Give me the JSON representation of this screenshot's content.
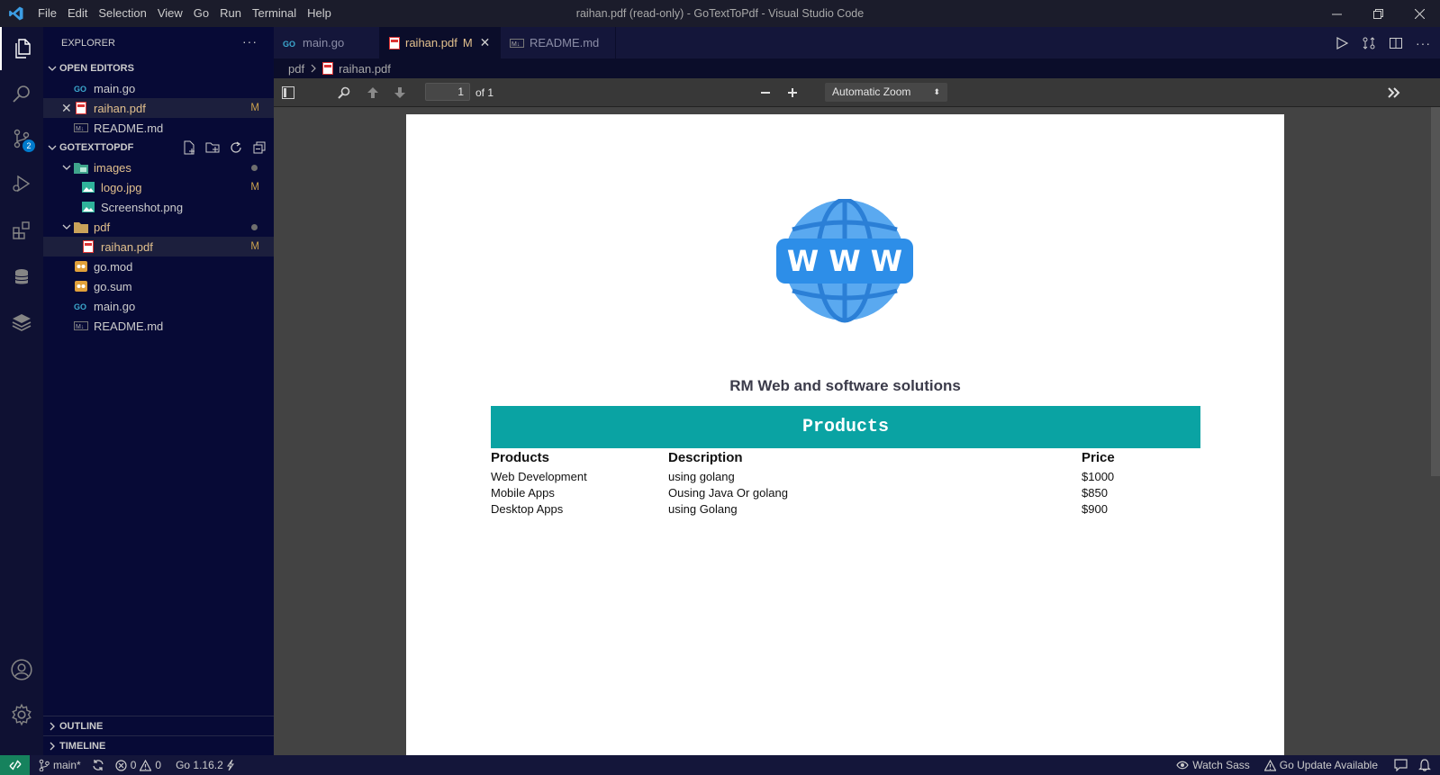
{
  "titlebar": {
    "menu": [
      "File",
      "Edit",
      "Selection",
      "View",
      "Go",
      "Run",
      "Terminal",
      "Help"
    ],
    "window_title": "raihan.pdf (read-only) - GoTextToPdf - Visual Studio Code"
  },
  "activitybar": {
    "scm_badge": "2"
  },
  "sidebar": {
    "header": "EXPLORER",
    "more": "···",
    "open_editors": {
      "title": "OPEN EDITORS",
      "items": [
        {
          "name": "main.go",
          "status": ""
        },
        {
          "name": "raihan.pdf",
          "status": "M"
        },
        {
          "name": "README.md",
          "status": ""
        }
      ]
    },
    "project": {
      "title": "GOTEXTTOPDF",
      "folder_images": "images",
      "logo": "logo.jpg",
      "logo_status": "M",
      "screenshot": "Screenshot.png",
      "folder_pdf": "pdf",
      "pdf_file": "raihan.pdf",
      "pdf_status": "M",
      "gomod": "go.mod",
      "gosum": "go.sum",
      "maingo": "main.go",
      "readme": "README.md"
    },
    "outline": "OUTLINE",
    "timeline": "TIMELINE"
  },
  "tabs": [
    {
      "label": "main.go"
    },
    {
      "label": "raihan.pdf",
      "status": "M"
    },
    {
      "label": "README.md"
    }
  ],
  "breadcrumb": {
    "folder": "pdf",
    "file": "raihan.pdf"
  },
  "pdf_toolbar": {
    "page_number": "1",
    "page_count": "of 1",
    "zoom": "Automatic Zoom"
  },
  "pdf": {
    "logo_text": "W W W",
    "company": "RM Web and software solutions",
    "banner": "Products",
    "headers": [
      "Products",
      "Description",
      "Price"
    ],
    "rows": [
      [
        "Web Development",
        "using golang",
        "$1000"
      ],
      [
        "Mobile Apps",
        "Ousing Java Or golang",
        "$850"
      ],
      [
        "Desktop Apps",
        "using Golang",
        "$900"
      ]
    ]
  },
  "statusbar": {
    "branch": "main*",
    "errors": "0",
    "warnings": "0",
    "go_version": "Go 1.16.2",
    "watch_sass": "Watch Sass",
    "go_update": "Go Update Available"
  },
  "colors": {
    "accent": "#007acc",
    "banner": "#0aa3a3",
    "modified": "#e2c08d",
    "globe": "#5aa9f0"
  }
}
